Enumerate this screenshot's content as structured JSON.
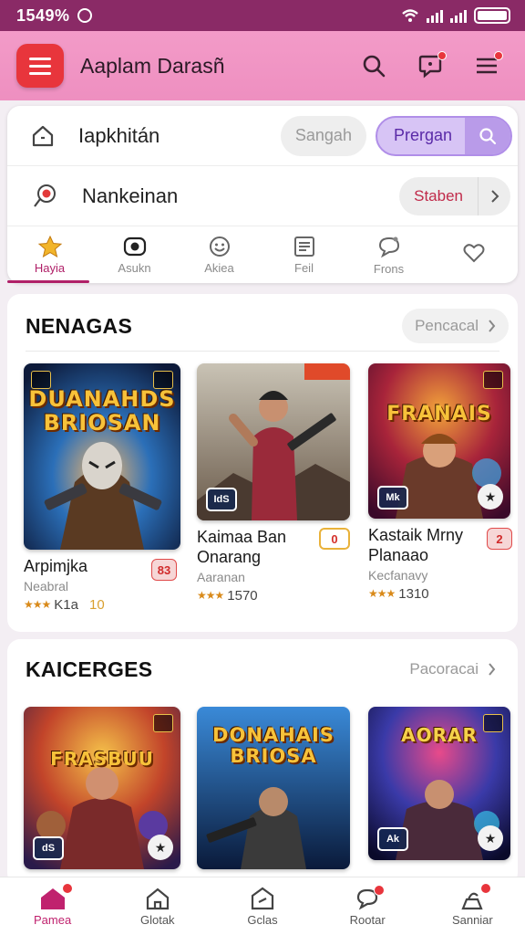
{
  "status": {
    "time": "1549%"
  },
  "header": {
    "title": "Aaplam Darasñ"
  },
  "top_rows": {
    "row1": {
      "label": "Iapkhitán",
      "search_placeholder": "Sangah",
      "action_label": "Prergan"
    },
    "row2": {
      "label": "Nankeinan",
      "chip_label": "Staben"
    }
  },
  "tabs": [
    {
      "label": "Hayia",
      "icon": "star-icon"
    },
    {
      "label": "Asukn",
      "icon": "record-icon"
    },
    {
      "label": "Akiea",
      "icon": "smile-icon"
    },
    {
      "label": "Feil",
      "icon": "news-icon"
    },
    {
      "label": "Frons",
      "icon": "comment-icon"
    },
    {
      "label": "",
      "icon": "heart-icon"
    }
  ],
  "section1": {
    "title": "NENAGAS",
    "link": "Pencacal",
    "games": [
      {
        "poster_title": "DUANAHDS BRIOSAN",
        "name": "Arpimjka",
        "sub": "Neabral",
        "rating": "K1a",
        "extra": "10",
        "badge": "83"
      },
      {
        "poster_title": "",
        "poster_badge": "IdS",
        "name": "Kaimaa Ban Onarang",
        "sub": "Aaranan",
        "rating": "1570",
        "badge": "0"
      },
      {
        "poster_title": "FRANAIS",
        "poster_badge": "Mk",
        "name": "Kastaik Mrny Planaao",
        "sub": "Kecfanavy",
        "rating": "1310",
        "badge": "2"
      }
    ]
  },
  "section2": {
    "title": "KAICERGES",
    "link": "Pacoracai",
    "games": [
      {
        "poster_title": "FRASBUU",
        "poster_badge": "dS"
      },
      {
        "poster_title": "DONAHAIS BRIOSA"
      },
      {
        "poster_title": "AORAR",
        "poster_badge": "Ak"
      }
    ]
  },
  "bottom_nav": [
    {
      "label": "Pamea",
      "icon": "home-icon",
      "active": true
    },
    {
      "label": "Glotak",
      "icon": "house-outline-icon"
    },
    {
      "label": "Gclas",
      "icon": "tag-icon"
    },
    {
      "label": "Rootar",
      "icon": "comment-icon"
    },
    {
      "label": "Sanniar",
      "icon": "user-icon"
    }
  ]
}
